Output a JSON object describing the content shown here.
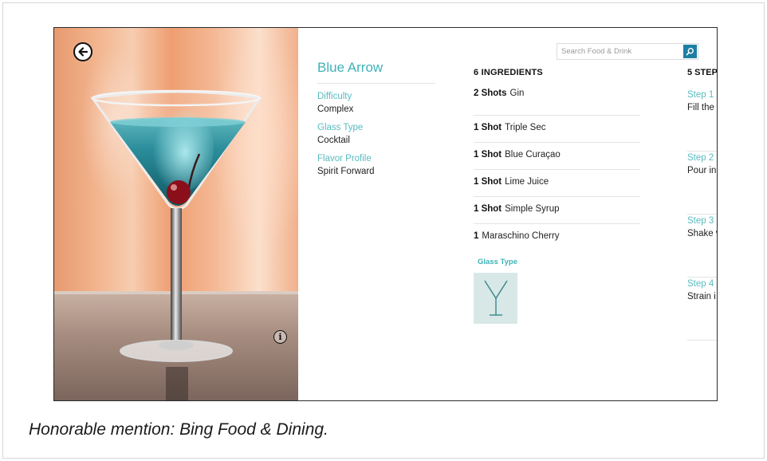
{
  "app": {
    "search": {
      "placeholder": "Search Food & Drink"
    },
    "recipe": {
      "title": "Blue Arrow",
      "details": [
        {
          "label": "Difficulty",
          "value": "Complex"
        },
        {
          "label": "Glass Type",
          "value": "Cocktail"
        },
        {
          "label": "Flavor Profile",
          "value": "Spirit Forward"
        }
      ]
    },
    "ingredients": {
      "header": "6 INGREDIENTS",
      "items": [
        {
          "qty": "2 Shots",
          "name": "Gin"
        },
        {
          "qty": "1 Shot",
          "name": "Triple Sec"
        },
        {
          "qty": "1 Shot",
          "name": "Blue Curaçao"
        },
        {
          "qty": "1 Shot",
          "name": "Lime Juice"
        },
        {
          "qty": "1 Shot",
          "name": "Simple Syrup"
        },
        {
          "qty": "1",
          "name": "Maraschino Cherry"
        }
      ],
      "glass_type_label": "Glass Type"
    },
    "steps": {
      "header": "5 STEP",
      "items": [
        {
          "label": "Step 1",
          "text": "Fill the"
        },
        {
          "label": "Step 2",
          "text": "Pour in"
        },
        {
          "label": "Step 3",
          "text": "Shake v"
        },
        {
          "label": "Step 4",
          "text": "Strain i"
        }
      ]
    },
    "icons": {
      "back": "back-arrow-icon",
      "info": "info-icon",
      "search": "search-icon",
      "glass": "cocktail-glass-icon"
    },
    "colors": {
      "accent": "#3fb2b8",
      "search_button": "#1e7fa3",
      "glass_tile": "#d7e8e7"
    }
  },
  "caption": "Honorable mention: Bing Food & Dining."
}
